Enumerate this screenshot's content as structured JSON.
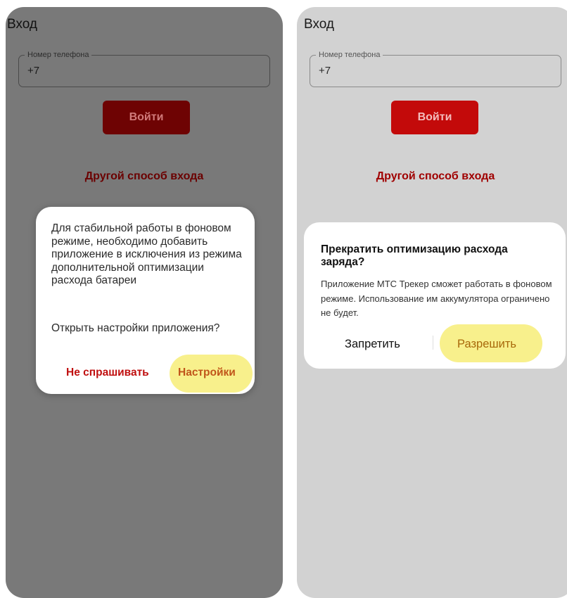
{
  "left_screen": {
    "appbar_title": "Вход",
    "phone_field": {
      "label": "Номер телефона",
      "value": "+7"
    },
    "login_button": "Войти",
    "alt_login_link": "Другой способ входа",
    "dialog": {
      "message": "Для стабильной работы в фоновом режиме, необходимо добавить приложение в исключения из режима дополнительной оптимизации расхода батареи",
      "question": "Открыть настройки приложения?",
      "negative_button": "Не спрашивать",
      "positive_button": "Настройки"
    }
  },
  "right_screen": {
    "appbar_title": "Вход",
    "phone_field": {
      "label": "Номер телефона",
      "value": "+7"
    },
    "login_button": "Войти",
    "alt_login_link": "Другой способ входа",
    "dialog": {
      "title": "Прекратить оптимизацию расхода заряда?",
      "message": "Приложение МТС Трекер сможет работать в фоновом режиме. Использование им аккумулятора ограничено не будет.",
      "negative_button": "Запретить",
      "positive_button": "Разрешить"
    }
  },
  "colors": {
    "brand_red": "#c30a0a",
    "highlight_yellow": "#f8f08c",
    "dim_overlay": "#797979"
  }
}
